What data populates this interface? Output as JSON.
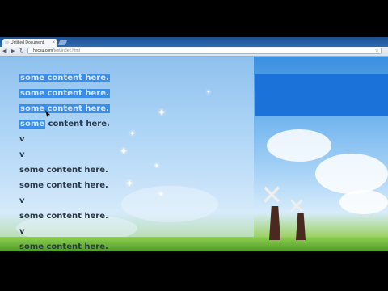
{
  "browser": {
    "tab_title": "Untitled Document",
    "tab_close": "×",
    "url_host": "hecsu.com",
    "url_path": "/test/index.html",
    "back_glyph": "◀",
    "forward_glyph": "▶",
    "reload_glyph": "↻",
    "star_glyph": "☆",
    "menu_glyph": "🔧"
  },
  "page": {
    "lines": [
      {
        "text": "some content here.",
        "selected": "full"
      },
      {
        "text": "some content here.",
        "selected": "full"
      },
      {
        "text": "some content here.",
        "selected": "full"
      },
      {
        "text": "some content here.",
        "selected": "partial"
      },
      {
        "text": "v",
        "selected": "none"
      },
      {
        "text": "v",
        "selected": "none"
      },
      {
        "text": "some content here.",
        "selected": "none"
      },
      {
        "text": "some content here.",
        "selected": "none"
      },
      {
        "text": "v",
        "selected": "none"
      },
      {
        "text": "some content here.",
        "selected": "none"
      },
      {
        "text": "v",
        "selected": "none"
      },
      {
        "text": "some content here.",
        "selected": "none"
      }
    ],
    "colors": {
      "selection": "#3b8ee8",
      "text": "#2b3a4a",
      "sky": "#3a8fe0"
    }
  }
}
